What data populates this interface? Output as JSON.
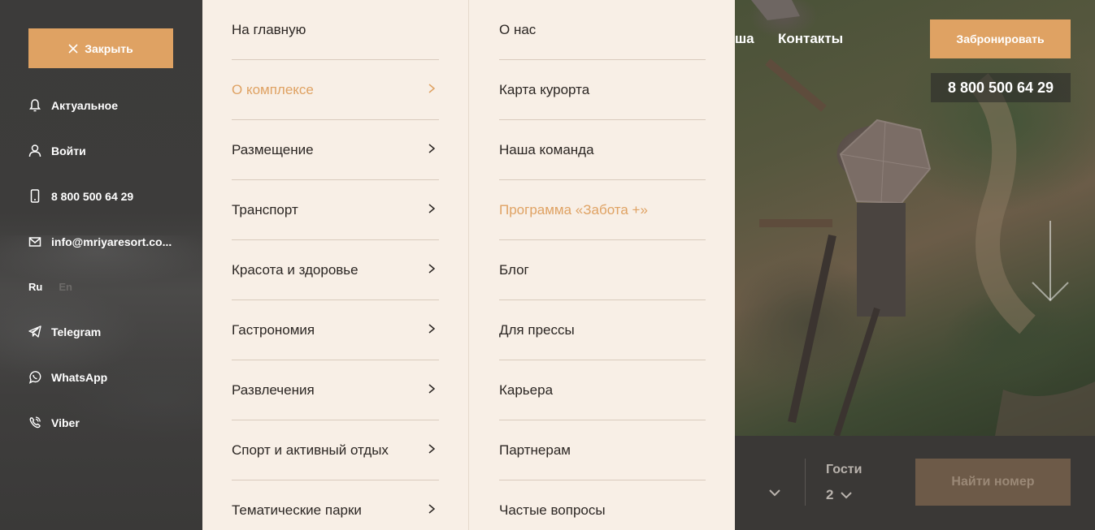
{
  "sidebar": {
    "close_label": "Закрыть",
    "items": [
      {
        "label": "Актуальное",
        "icon": "bell-icon"
      },
      {
        "label": "Войти",
        "icon": "user-icon"
      },
      {
        "label": "8 800 500 64 29",
        "icon": "phone-icon"
      },
      {
        "label": "info@mriyaresort.co...",
        "icon": "mail-icon"
      },
      {
        "label": "Telegram",
        "icon": "telegram-icon"
      },
      {
        "label": "WhatsApp",
        "icon": "whatsapp-icon"
      },
      {
        "label": "Viber",
        "icon": "viber-icon"
      }
    ],
    "lang_active": "Ru",
    "lang_inactive": "En"
  },
  "menu": {
    "col1": [
      {
        "label": "На главную",
        "has_arrow": false,
        "highlighted": false
      },
      {
        "label": "О комплексе",
        "has_arrow": true,
        "highlighted": true
      },
      {
        "label": "Размещение",
        "has_arrow": true,
        "highlighted": false
      },
      {
        "label": "Транспорт",
        "has_arrow": true,
        "highlighted": false
      },
      {
        "label": "Красота и здоровье",
        "has_arrow": true,
        "highlighted": false
      },
      {
        "label": "Гастрономия",
        "has_arrow": true,
        "highlighted": false
      },
      {
        "label": "Развлечения",
        "has_arrow": true,
        "highlighted": false
      },
      {
        "label": "Спорт и активный отдых",
        "has_arrow": true,
        "highlighted": false
      },
      {
        "label": "Тематические парки",
        "has_arrow": true,
        "highlighted": false
      }
    ],
    "col2": [
      {
        "label": "О нас",
        "highlighted": false
      },
      {
        "label": "Карта курорта",
        "highlighted": false
      },
      {
        "label": "Наша команда",
        "highlighted": false
      },
      {
        "label": "Программа «Забота +»",
        "highlighted": true
      },
      {
        "label": "Блог",
        "highlighted": false
      },
      {
        "label": "Для прессы",
        "highlighted": false
      },
      {
        "label": "Карьера",
        "highlighted": false
      },
      {
        "label": "Партнерам",
        "highlighted": false
      },
      {
        "label": "Частые вопросы",
        "highlighted": false
      }
    ]
  },
  "header": {
    "nav_partial": "ша",
    "nav_contacts": "Контакты",
    "book_label": "Забронировать",
    "phone": "8 800 500 64 29"
  },
  "booking": {
    "guests_label": "Гости",
    "guests_value": "2",
    "find_label": "Найти номер"
  },
  "colors": {
    "accent": "#dfa263",
    "menu_bg": "#f8efe6",
    "text_dark": "#2b2623"
  }
}
